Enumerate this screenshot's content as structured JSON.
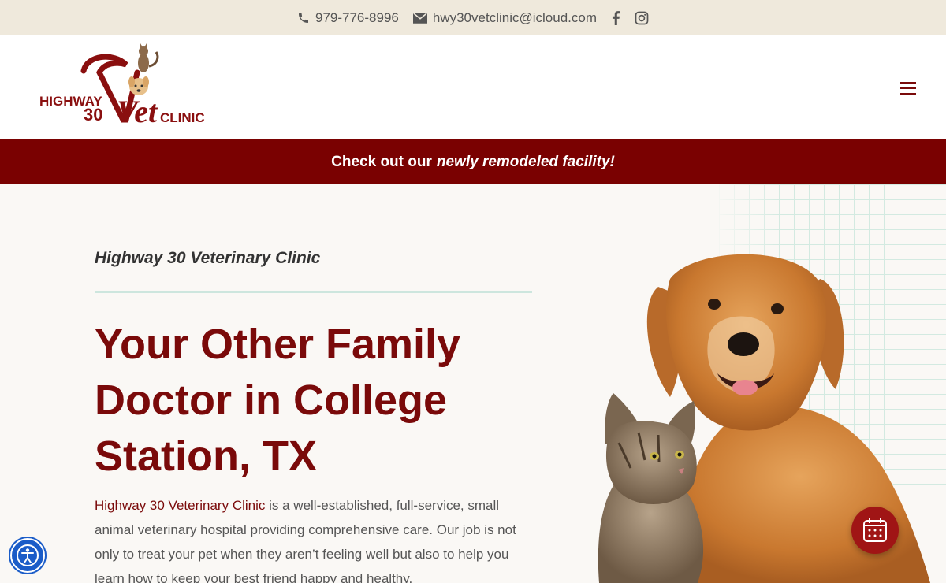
{
  "topbar": {
    "phone": "979-776-8996",
    "email": "hwy30vetclinic@icloud.com",
    "social_icons": [
      "facebook-icon",
      "instagram-icon"
    ]
  },
  "logo": {
    "line_1": "HIGHWAY",
    "number": "30",
    "word": "Vet",
    "line_2": "CLINIC"
  },
  "promo": {
    "prefix": "Check out our",
    "link": "newly remodeled facility!"
  },
  "hero": {
    "eyebrow": "Highway 30 Veterinary Clinic",
    "headline_line_1": "Your Other Family",
    "headline_line_2": "Doctor in College",
    "headline_line_3": "Station, TX",
    "intro_link": "Highway 30 Veterinary Clinic",
    "intro_rest": " is a well-established, full-service, small animal veterinary hospital providing comprehensive care. Our job is not only to treat your pet when they aren’t feeling well but also to help you learn how to keep your best friend happy and healthy."
  },
  "colors": {
    "brand": "#7a0a0a",
    "topbar_bg": "#efe9dc",
    "promo_bg": "#7a0101",
    "accent_line": "#cde6de",
    "accessibility": "#1a5cc8"
  },
  "widgets": {
    "calendar_icon": "calendar-icon",
    "accessibility_icon": "accessibility-icon"
  }
}
